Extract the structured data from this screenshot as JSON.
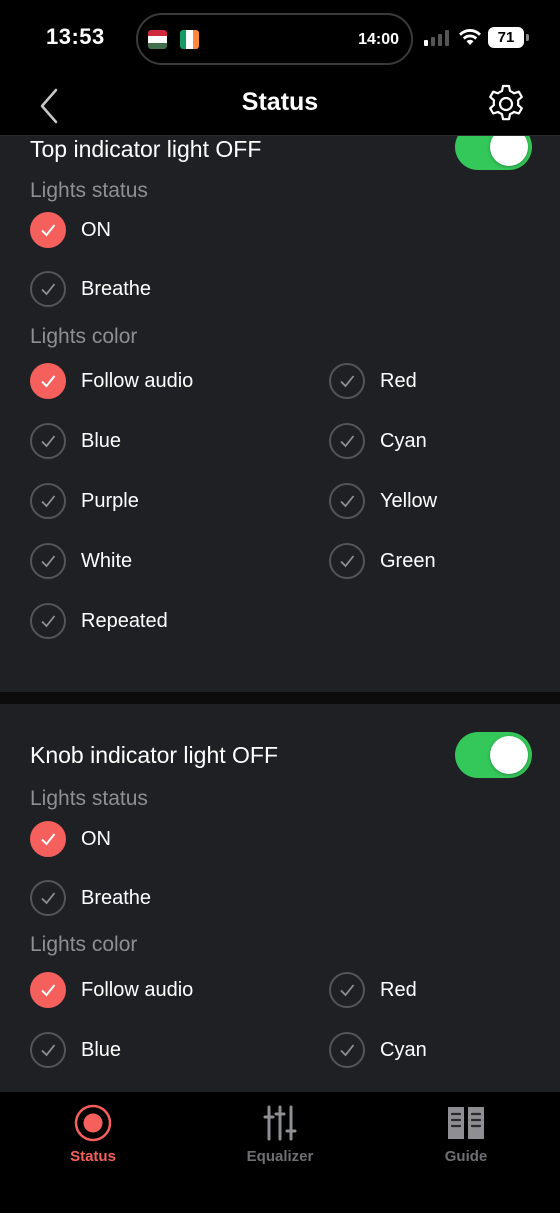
{
  "status_bar": {
    "time": "13:53",
    "island_time": "14:00",
    "battery": "71"
  },
  "nav": {
    "title": "Status",
    "back_icon": "chevron-left-icon",
    "settings_icon": "gear-icon"
  },
  "colors": {
    "accent": "#f5605d",
    "toggle_on": "#34c759",
    "panel": "#1f2023"
  },
  "sections": [
    {
      "title": "Top indicator light",
      "state": "OFF",
      "toggle_on": true,
      "lights_status_label": "Lights status",
      "status_options": [
        {
          "label": "ON",
          "checked": true
        },
        {
          "label": "Breathe",
          "checked": false
        }
      ],
      "lights_color_label": "Lights color",
      "color_options": [
        {
          "label": "Follow audio",
          "checked": true
        },
        {
          "label": "Red",
          "checked": false
        },
        {
          "label": "Blue",
          "checked": false
        },
        {
          "label": "Cyan",
          "checked": false
        },
        {
          "label": "Purple",
          "checked": false
        },
        {
          "label": "Yellow",
          "checked": false
        },
        {
          "label": "White",
          "checked": false
        },
        {
          "label": "Green",
          "checked": false
        },
        {
          "label": "Repeated",
          "checked": false
        }
      ]
    },
    {
      "title": "Knob indicator light",
      "state": "OFF",
      "toggle_on": true,
      "lights_status_label": "Lights status",
      "status_options": [
        {
          "label": "ON",
          "checked": true
        },
        {
          "label": "Breathe",
          "checked": false
        }
      ],
      "lights_color_label": "Lights color",
      "color_options": [
        {
          "label": "Follow audio",
          "checked": true
        },
        {
          "label": "Red",
          "checked": false
        },
        {
          "label": "Blue",
          "checked": false
        },
        {
          "label": "Cyan",
          "checked": false
        }
      ]
    }
  ],
  "tabs": [
    {
      "label": "Status",
      "icon": "record-icon",
      "active": true
    },
    {
      "label": "Equalizer",
      "icon": "sliders-icon",
      "active": false
    },
    {
      "label": "Guide",
      "icon": "book-icon",
      "active": false
    }
  ]
}
